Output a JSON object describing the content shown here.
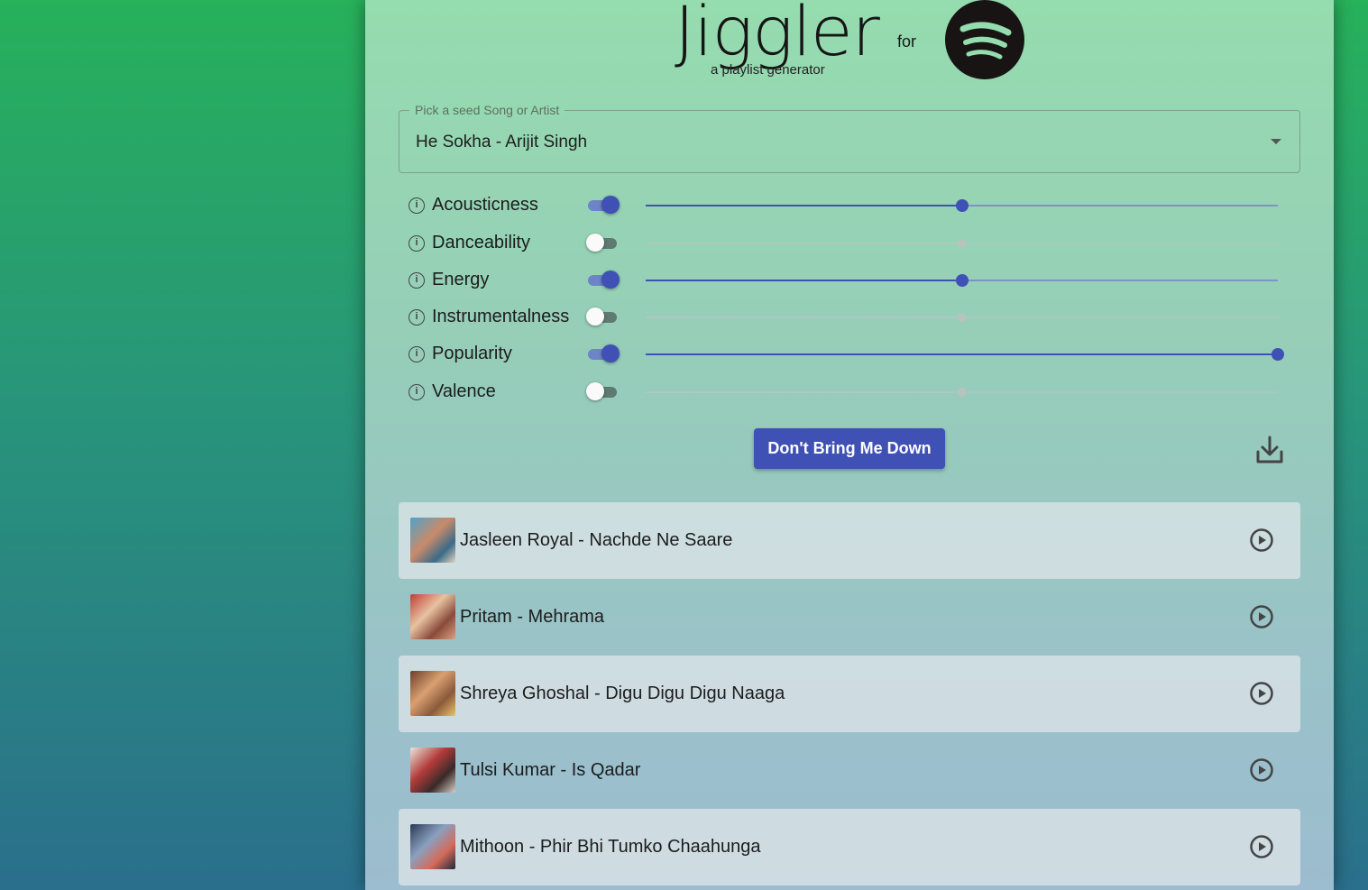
{
  "header": {
    "title": "Jiggler",
    "subtitle": "a playlist generator",
    "for_label": "for",
    "logo_icon": "spotify-logo-icon"
  },
  "seed": {
    "label": "Pick a seed Song or Artist",
    "value": "He Sokha - Arijit Singh"
  },
  "features": [
    {
      "label": "Acousticness",
      "enabled": true,
      "value": 0.5
    },
    {
      "label": "Danceability",
      "enabled": false,
      "value": 0.5
    },
    {
      "label": "Energy",
      "enabled": true,
      "value": 0.5
    },
    {
      "label": "Instrumentalness",
      "enabled": false,
      "value": 0.5
    },
    {
      "label": "Popularity",
      "enabled": true,
      "value": 1.0
    },
    {
      "label": "Valence",
      "enabled": false,
      "value": 0.5
    }
  ],
  "actions": {
    "generate_label": "Don't Bring Me Down",
    "download_icon": "download-icon"
  },
  "tracks": [
    {
      "title": "Jasleen Royal - Nachde Ne Saare"
    },
    {
      "title": "Pritam - Mehrama"
    },
    {
      "title": "Shreya Ghoshal - Digu Digu Digu Naaga"
    },
    {
      "title": "Tulsi Kumar - Is Qadar"
    },
    {
      "title": "Mithoon - Phir Bhi Tumko Chaahunga"
    }
  ],
  "colors": {
    "accent": "#3f51b5",
    "panel_top": "#95dcae",
    "background_top": "#27b15a",
    "background_bottom": "#2a6f8c"
  }
}
